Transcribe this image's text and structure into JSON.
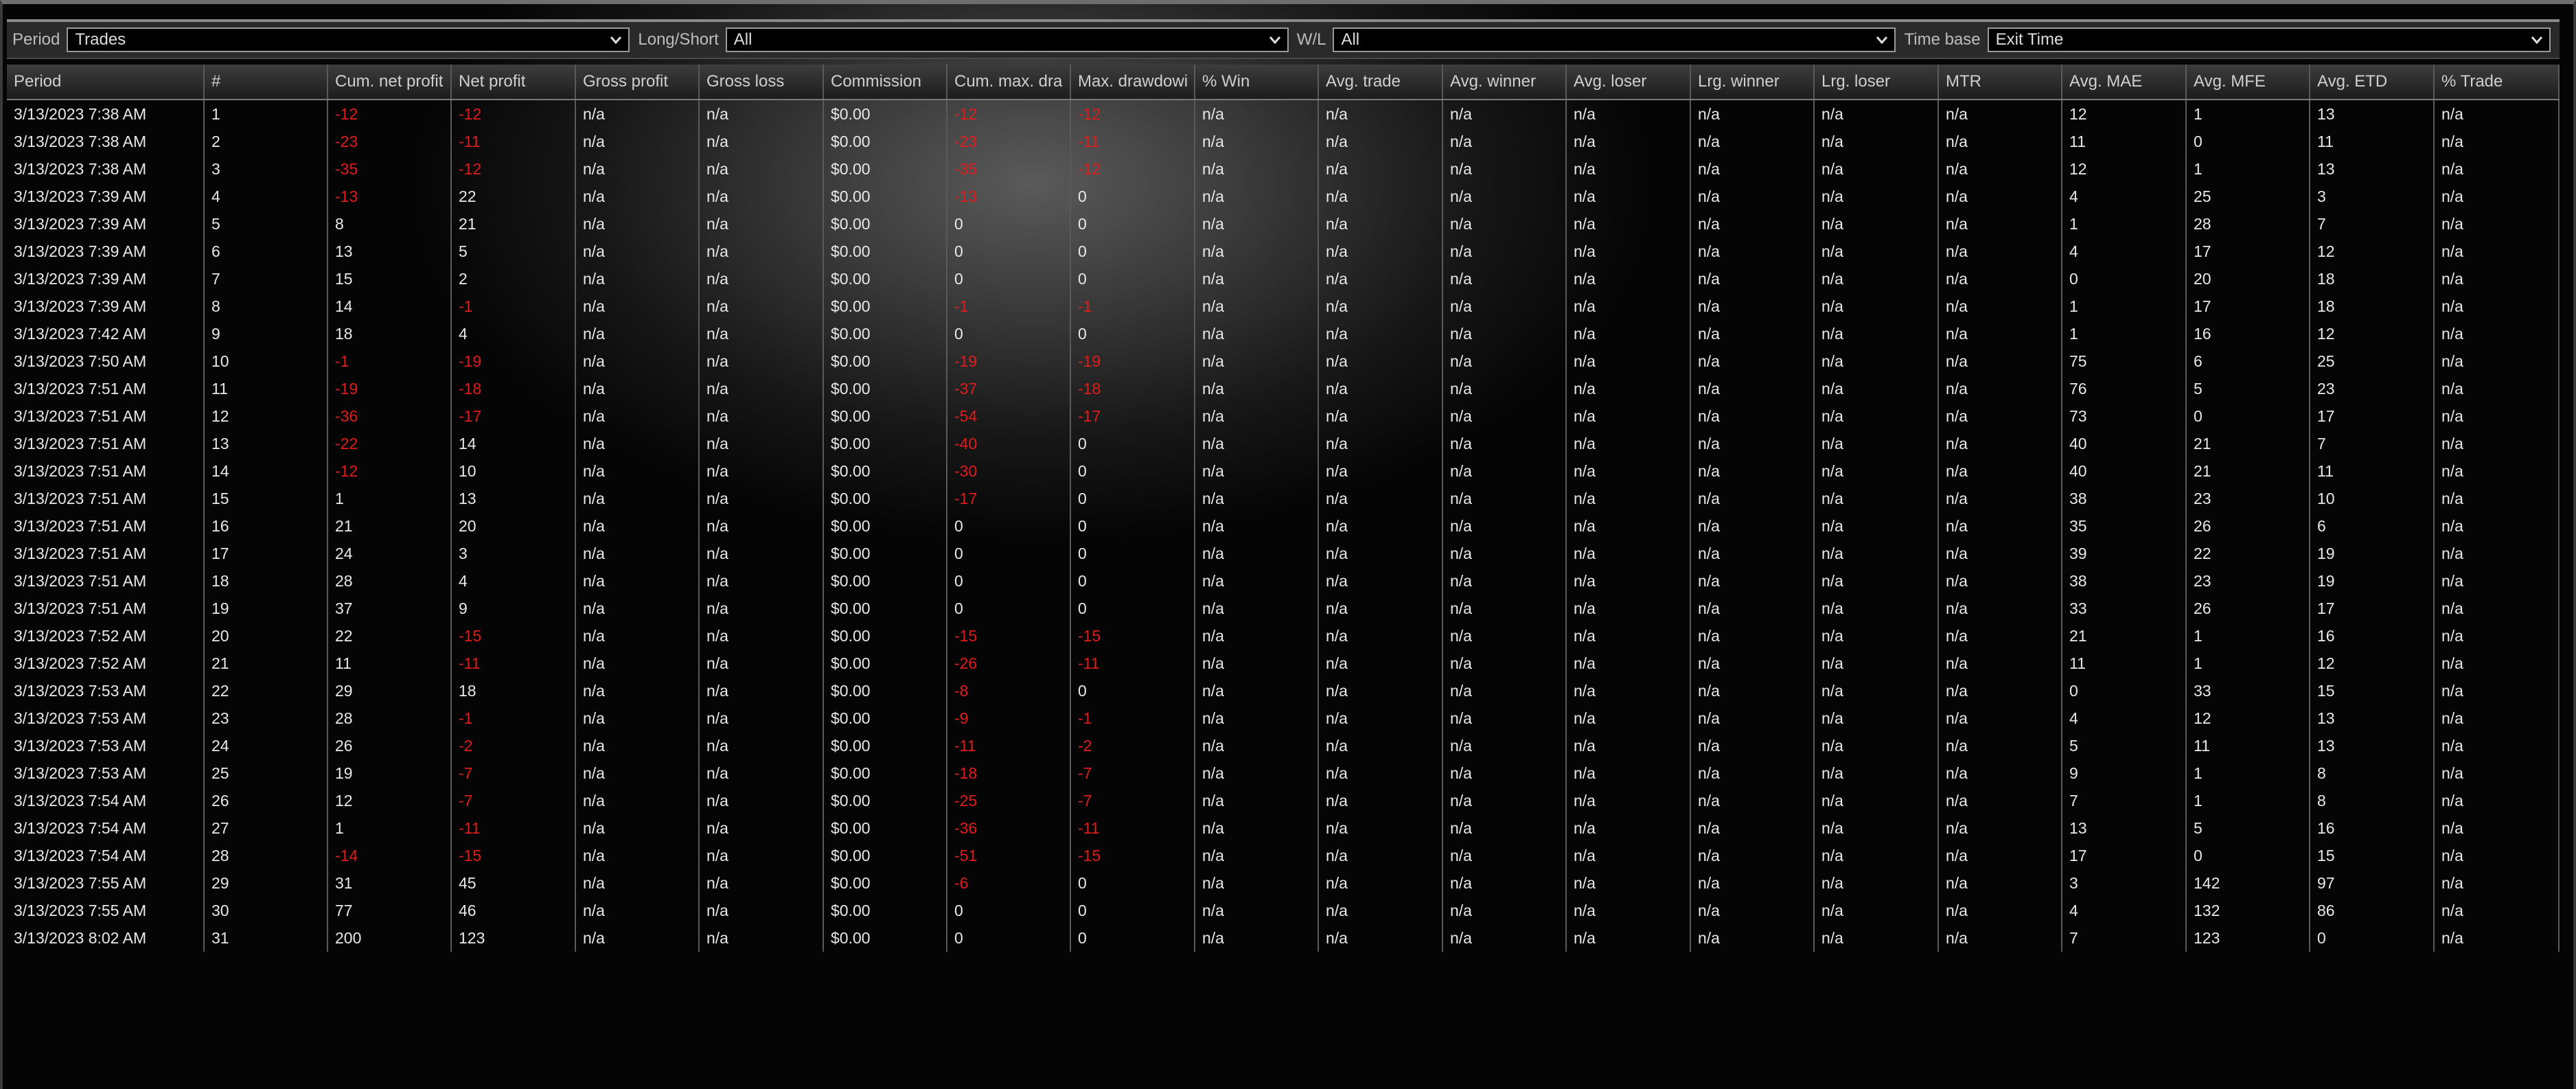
{
  "filters": [
    {
      "label": "Period",
      "value": "Trades"
    },
    {
      "label": "Long/Short",
      "value": "All"
    },
    {
      "label": "W/L",
      "value": "All"
    },
    {
      "label": "Time base",
      "value": "Exit Time"
    }
  ],
  "columns": [
    "Period",
    "#",
    "Cum. net profit",
    "Net profit",
    "Gross profit",
    "Gross loss",
    "Commission",
    "Cum. max. dra",
    "Max. drawdowi",
    "% Win",
    "Avg. trade",
    "Avg. winner",
    "Avg. loser",
    "Lrg. winner",
    "Lrg. loser",
    "MTR",
    "Avg. MAE",
    "Avg. MFE",
    "Avg. ETD",
    "% Trade"
  ],
  "rows": [
    [
      "3/13/2023 7:38 AM",
      "1",
      "-12",
      "-12",
      "n/a",
      "n/a",
      "$0.00",
      "-12",
      "-12",
      "n/a",
      "n/a",
      "n/a",
      "n/a",
      "n/a",
      "n/a",
      "n/a",
      "12",
      "1",
      "13",
      "n/a"
    ],
    [
      "3/13/2023 7:38 AM",
      "2",
      "-23",
      "-11",
      "n/a",
      "n/a",
      "$0.00",
      "-23",
      "-11",
      "n/a",
      "n/a",
      "n/a",
      "n/a",
      "n/a",
      "n/a",
      "n/a",
      "11",
      "0",
      "11",
      "n/a"
    ],
    [
      "3/13/2023 7:38 AM",
      "3",
      "-35",
      "-12",
      "n/a",
      "n/a",
      "$0.00",
      "-35",
      "-12",
      "n/a",
      "n/a",
      "n/a",
      "n/a",
      "n/a",
      "n/a",
      "n/a",
      "12",
      "1",
      "13",
      "n/a"
    ],
    [
      "3/13/2023 7:39 AM",
      "4",
      "-13",
      "22",
      "n/a",
      "n/a",
      "$0.00",
      "-13",
      "0",
      "n/a",
      "n/a",
      "n/a",
      "n/a",
      "n/a",
      "n/a",
      "n/a",
      "4",
      "25",
      "3",
      "n/a"
    ],
    [
      "3/13/2023 7:39 AM",
      "5",
      "8",
      "21",
      "n/a",
      "n/a",
      "$0.00",
      "0",
      "0",
      "n/a",
      "n/a",
      "n/a",
      "n/a",
      "n/a",
      "n/a",
      "n/a",
      "1",
      "28",
      "7",
      "n/a"
    ],
    [
      "3/13/2023 7:39 AM",
      "6",
      "13",
      "5",
      "n/a",
      "n/a",
      "$0.00",
      "0",
      "0",
      "n/a",
      "n/a",
      "n/a",
      "n/a",
      "n/a",
      "n/a",
      "n/a",
      "4",
      "17",
      "12",
      "n/a"
    ],
    [
      "3/13/2023 7:39 AM",
      "7",
      "15",
      "2",
      "n/a",
      "n/a",
      "$0.00",
      "0",
      "0",
      "n/a",
      "n/a",
      "n/a",
      "n/a",
      "n/a",
      "n/a",
      "n/a",
      "0",
      "20",
      "18",
      "n/a"
    ],
    [
      "3/13/2023 7:39 AM",
      "8",
      "14",
      "-1",
      "n/a",
      "n/a",
      "$0.00",
      "-1",
      "-1",
      "n/a",
      "n/a",
      "n/a",
      "n/a",
      "n/a",
      "n/a",
      "n/a",
      "1",
      "17",
      "18",
      "n/a"
    ],
    [
      "3/13/2023 7:42 AM",
      "9",
      "18",
      "4",
      "n/a",
      "n/a",
      "$0.00",
      "0",
      "0",
      "n/a",
      "n/a",
      "n/a",
      "n/a",
      "n/a",
      "n/a",
      "n/a",
      "1",
      "16",
      "12",
      "n/a"
    ],
    [
      "3/13/2023 7:50 AM",
      "10",
      "-1",
      "-19",
      "n/a",
      "n/a",
      "$0.00",
      "-19",
      "-19",
      "n/a",
      "n/a",
      "n/a",
      "n/a",
      "n/a",
      "n/a",
      "n/a",
      "75",
      "6",
      "25",
      "n/a"
    ],
    [
      "3/13/2023 7:51 AM",
      "11",
      "-19",
      "-18",
      "n/a",
      "n/a",
      "$0.00",
      "-37",
      "-18",
      "n/a",
      "n/a",
      "n/a",
      "n/a",
      "n/a",
      "n/a",
      "n/a",
      "76",
      "5",
      "23",
      "n/a"
    ],
    [
      "3/13/2023 7:51 AM",
      "12",
      "-36",
      "-17",
      "n/a",
      "n/a",
      "$0.00",
      "-54",
      "-17",
      "n/a",
      "n/a",
      "n/a",
      "n/a",
      "n/a",
      "n/a",
      "n/a",
      "73",
      "0",
      "17",
      "n/a"
    ],
    [
      "3/13/2023 7:51 AM",
      "13",
      "-22",
      "14",
      "n/a",
      "n/a",
      "$0.00",
      "-40",
      "0",
      "n/a",
      "n/a",
      "n/a",
      "n/a",
      "n/a",
      "n/a",
      "n/a",
      "40",
      "21",
      "7",
      "n/a"
    ],
    [
      "3/13/2023 7:51 AM",
      "14",
      "-12",
      "10",
      "n/a",
      "n/a",
      "$0.00",
      "-30",
      "0",
      "n/a",
      "n/a",
      "n/a",
      "n/a",
      "n/a",
      "n/a",
      "n/a",
      "40",
      "21",
      "11",
      "n/a"
    ],
    [
      "3/13/2023 7:51 AM",
      "15",
      "1",
      "13",
      "n/a",
      "n/a",
      "$0.00",
      "-17",
      "0",
      "n/a",
      "n/a",
      "n/a",
      "n/a",
      "n/a",
      "n/a",
      "n/a",
      "38",
      "23",
      "10",
      "n/a"
    ],
    [
      "3/13/2023 7:51 AM",
      "16",
      "21",
      "20",
      "n/a",
      "n/a",
      "$0.00",
      "0",
      "0",
      "n/a",
      "n/a",
      "n/a",
      "n/a",
      "n/a",
      "n/a",
      "n/a",
      "35",
      "26",
      "6",
      "n/a"
    ],
    [
      "3/13/2023 7:51 AM",
      "17",
      "24",
      "3",
      "n/a",
      "n/a",
      "$0.00",
      "0",
      "0",
      "n/a",
      "n/a",
      "n/a",
      "n/a",
      "n/a",
      "n/a",
      "n/a",
      "39",
      "22",
      "19",
      "n/a"
    ],
    [
      "3/13/2023 7:51 AM",
      "18",
      "28",
      "4",
      "n/a",
      "n/a",
      "$0.00",
      "0",
      "0",
      "n/a",
      "n/a",
      "n/a",
      "n/a",
      "n/a",
      "n/a",
      "n/a",
      "38",
      "23",
      "19",
      "n/a"
    ],
    [
      "3/13/2023 7:51 AM",
      "19",
      "37",
      "9",
      "n/a",
      "n/a",
      "$0.00",
      "0",
      "0",
      "n/a",
      "n/a",
      "n/a",
      "n/a",
      "n/a",
      "n/a",
      "n/a",
      "33",
      "26",
      "17",
      "n/a"
    ],
    [
      "3/13/2023 7:52 AM",
      "20",
      "22",
      "-15",
      "n/a",
      "n/a",
      "$0.00",
      "-15",
      "-15",
      "n/a",
      "n/a",
      "n/a",
      "n/a",
      "n/a",
      "n/a",
      "n/a",
      "21",
      "1",
      "16",
      "n/a"
    ],
    [
      "3/13/2023 7:52 AM",
      "21",
      "11",
      "-11",
      "n/a",
      "n/a",
      "$0.00",
      "-26",
      "-11",
      "n/a",
      "n/a",
      "n/a",
      "n/a",
      "n/a",
      "n/a",
      "n/a",
      "11",
      "1",
      "12",
      "n/a"
    ],
    [
      "3/13/2023 7:53 AM",
      "22",
      "29",
      "18",
      "n/a",
      "n/a",
      "$0.00",
      "-8",
      "0",
      "n/a",
      "n/a",
      "n/a",
      "n/a",
      "n/a",
      "n/a",
      "n/a",
      "0",
      "33",
      "15",
      "n/a"
    ],
    [
      "3/13/2023 7:53 AM",
      "23",
      "28",
      "-1",
      "n/a",
      "n/a",
      "$0.00",
      "-9",
      "-1",
      "n/a",
      "n/a",
      "n/a",
      "n/a",
      "n/a",
      "n/a",
      "n/a",
      "4",
      "12",
      "13",
      "n/a"
    ],
    [
      "3/13/2023 7:53 AM",
      "24",
      "26",
      "-2",
      "n/a",
      "n/a",
      "$0.00",
      "-11",
      "-2",
      "n/a",
      "n/a",
      "n/a",
      "n/a",
      "n/a",
      "n/a",
      "n/a",
      "5",
      "11",
      "13",
      "n/a"
    ],
    [
      "3/13/2023 7:53 AM",
      "25",
      "19",
      "-7",
      "n/a",
      "n/a",
      "$0.00",
      "-18",
      "-7",
      "n/a",
      "n/a",
      "n/a",
      "n/a",
      "n/a",
      "n/a",
      "n/a",
      "9",
      "1",
      "8",
      "n/a"
    ],
    [
      "3/13/2023 7:54 AM",
      "26",
      "12",
      "-7",
      "n/a",
      "n/a",
      "$0.00",
      "-25",
      "-7",
      "n/a",
      "n/a",
      "n/a",
      "n/a",
      "n/a",
      "n/a",
      "n/a",
      "7",
      "1",
      "8",
      "n/a"
    ],
    [
      "3/13/2023 7:54 AM",
      "27",
      "1",
      "-11",
      "n/a",
      "n/a",
      "$0.00",
      "-36",
      "-11",
      "n/a",
      "n/a",
      "n/a",
      "n/a",
      "n/a",
      "n/a",
      "n/a",
      "13",
      "5",
      "16",
      "n/a"
    ],
    [
      "3/13/2023 7:54 AM",
      "28",
      "-14",
      "-15",
      "n/a",
      "n/a",
      "$0.00",
      "-51",
      "-15",
      "n/a",
      "n/a",
      "n/a",
      "n/a",
      "n/a",
      "n/a",
      "n/a",
      "17",
      "0",
      "15",
      "n/a"
    ],
    [
      "3/13/2023 7:55 AM",
      "29",
      "31",
      "45",
      "n/a",
      "n/a",
      "$0.00",
      "-6",
      "0",
      "n/a",
      "n/a",
      "n/a",
      "n/a",
      "n/a",
      "n/a",
      "n/a",
      "3",
      "142",
      "97",
      "n/a"
    ],
    [
      "3/13/2023 7:55 AM",
      "30",
      "77",
      "46",
      "n/a",
      "n/a",
      "$0.00",
      "0",
      "0",
      "n/a",
      "n/a",
      "n/a",
      "n/a",
      "n/a",
      "n/a",
      "n/a",
      "4",
      "132",
      "86",
      "n/a"
    ],
    [
      "3/13/2023 8:02 AM",
      "31",
      "200",
      "123",
      "n/a",
      "n/a",
      "$0.00",
      "0",
      "0",
      "n/a",
      "n/a",
      "n/a",
      "n/a",
      "n/a",
      "n/a",
      "n/a",
      "7",
      "123",
      "0",
      "n/a"
    ]
  ],
  "colors": {
    "negative": "#e01c1c",
    "text": "#e8e8e8",
    "header_text": "#cfcfcf"
  }
}
